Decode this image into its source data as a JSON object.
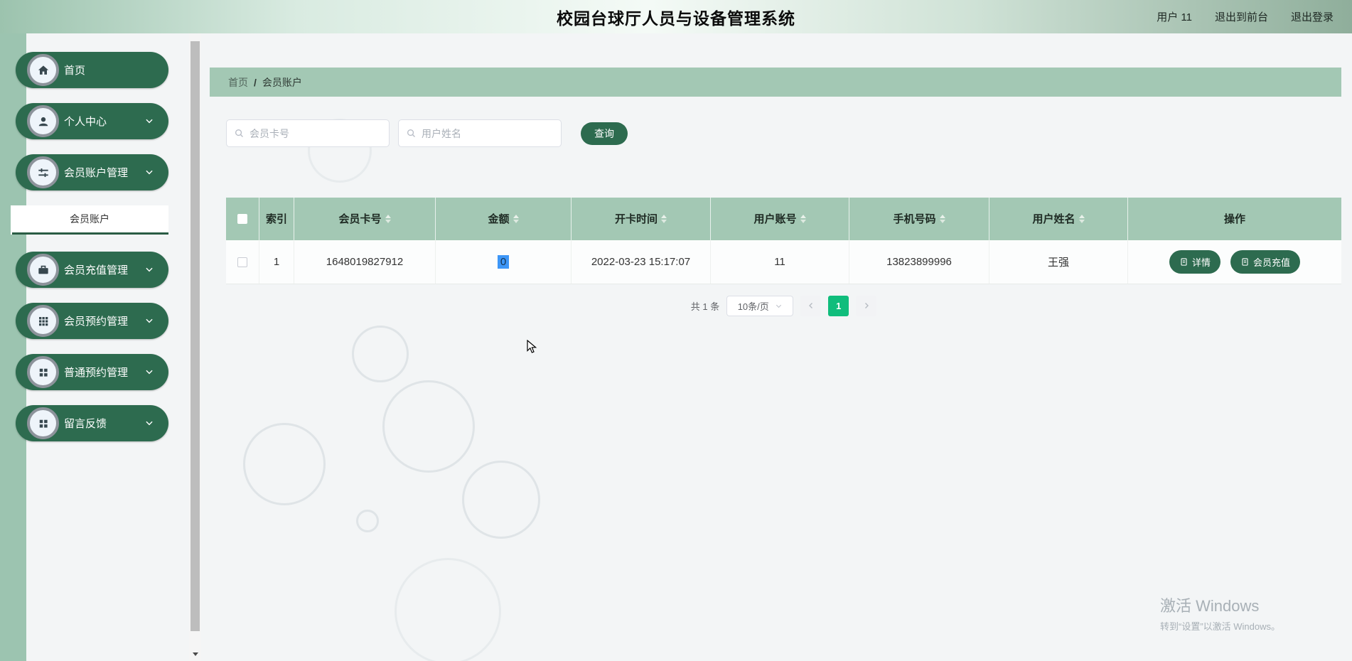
{
  "topbar": {
    "title": "校园台球厅人员与设备管理系统",
    "user": "用户 11",
    "back_front": "退出到前台",
    "logout": "退出登录"
  },
  "sidebar": {
    "items": [
      {
        "label": "首页",
        "icon": "home-icon",
        "expandable": false
      },
      {
        "label": "个人中心",
        "icon": "user-icon",
        "expandable": true
      },
      {
        "label": "会员账户管理",
        "icon": "sliders-icon",
        "expandable": true,
        "active": true
      },
      {
        "label": "会员充值管理",
        "icon": "briefcase-icon",
        "expandable": true
      },
      {
        "label": "会员预约管理",
        "icon": "grid-3x3-icon",
        "expandable": true
      },
      {
        "label": "普通预约管理",
        "icon": "grid-2x2-icon",
        "expandable": true
      },
      {
        "label": "留言反馈",
        "icon": "grid-2x2-icon",
        "expandable": true
      }
    ],
    "submenu_label": "会员账户"
  },
  "breadcrumb": {
    "root": "首页",
    "sep": "/",
    "current": "会员账户"
  },
  "search": {
    "card_placeholder": "会员卡号",
    "name_placeholder": "用户姓名",
    "query_button": "查询"
  },
  "table": {
    "headers": [
      "索引",
      "会员卡号",
      "金额",
      "开卡时间",
      "用户账号",
      "手机号码",
      "用户姓名",
      "操作"
    ],
    "row": {
      "index": "1",
      "card_no": "1648019827912",
      "amount": "0",
      "open_time": "2022-03-23 15:17:07",
      "user_account": "11",
      "phone": "13823899996",
      "user_name": "王强",
      "detail_button": "详情",
      "recharge_button": "会员充值"
    }
  },
  "pagination": {
    "total_text": "共 1 条",
    "page_size_text": "10条/页",
    "page": "1"
  },
  "watermark": {
    "title": "激活 Windows",
    "subtitle": "转到“设置”以激活 Windows。"
  },
  "icons": {
    "search": "magnifier",
    "chevron": "chevron-down",
    "sort": "up-down-carets",
    "doc": "document",
    "cursor": "arrow-pointer"
  },
  "colors": {
    "accent_green": "#2d6b4f",
    "sage_green": "#a3c8b4",
    "pager_green": "#10bd7c",
    "selection_blue": "#3d96f7"
  }
}
